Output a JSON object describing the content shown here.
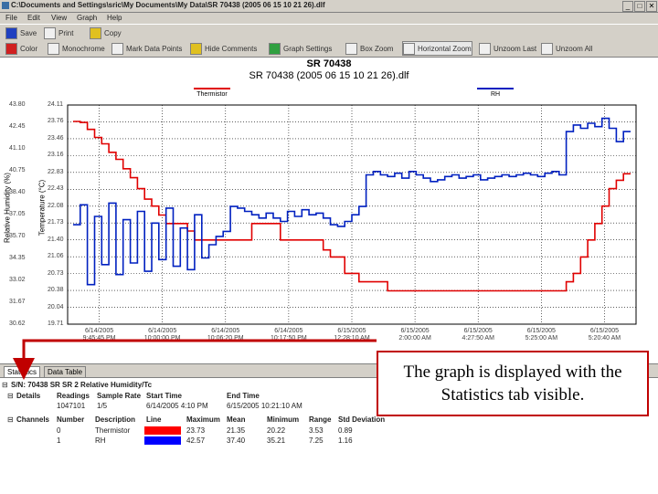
{
  "window": {
    "title": "C:\\Documents and Settings\\sric\\My Documents\\My Data\\SR 70438 (2005 06 15 10 21 26).dlf",
    "controls": [
      "_",
      "□",
      "✕"
    ]
  },
  "menu": [
    "File",
    "Edit",
    "View",
    "Graph",
    "Help"
  ],
  "toolbar1": [
    {
      "label": "Save",
      "icon": "save-icon"
    },
    {
      "label": "Print",
      "icon": "print-icon"
    },
    {
      "label": "Copy",
      "icon": "copy-icon"
    }
  ],
  "toolbar2": [
    {
      "label": "Color",
      "icon": "color-icon"
    },
    {
      "label": "Monochrome",
      "icon": "monochrome-icon"
    },
    {
      "label": "Mark Data Points",
      "icon": "mark-points-icon"
    },
    {
      "label": "Hide Comments",
      "icon": "comments-icon"
    },
    {
      "label": "Graph Settings",
      "icon": "settings-icon"
    },
    {
      "label": "Box Zoom",
      "icon": "box-zoom-icon"
    },
    {
      "label": "Horizontal Zoom",
      "icon": "horizontal-zoom-icon",
      "pressed": true
    },
    {
      "label": "Unzoom Last",
      "icon": "unzoom-last-icon"
    },
    {
      "label": "Unzoom All",
      "icon": "unzoom-all-icon"
    }
  ],
  "chart_data": {
    "type": "line",
    "title": "SR 70438",
    "subtitle": "SR 70438 (2005 06 15 10 21 26).dlf",
    "ylabel_left_outer": "Relative Humidity (%)",
    "ylabel_left_inner": "Temperature (°C)",
    "y_rh_ticks": [
      "43.80",
      "42.45",
      "41.10",
      "40.75",
      "38.40",
      "37.05",
      "35.70",
      "34.35",
      "33.02",
      "31.67",
      "30.62"
    ],
    "y_temp_ticks": [
      "24.11",
      "23.76",
      "23.46",
      "23.16",
      "22.83",
      "22.43",
      "22.08",
      "21.73",
      "21.40",
      "21.06",
      "20.73",
      "20.38",
      "20.04",
      "19.71"
    ],
    "x_ticks": [
      [
        "6/14/2005",
        "9:45:45 PM"
      ],
      [
        "6/14/2005",
        "10:00:00 PM"
      ],
      [
        "6/14/2005",
        "10:06:20 PM"
      ],
      [
        "6/14/2005",
        "10:17:50 PM"
      ],
      [
        "6/15/2005",
        "12:28:10 AM"
      ],
      [
        "6/15/2005",
        "2:00:00 AM"
      ],
      [
        "6/15/2005",
        "4:27:50 AM"
      ],
      [
        "6/15/2005",
        "5:25:00 AM"
      ],
      [
        "6/15/2005",
        "5:20:40 AM"
      ]
    ],
    "series": [
      {
        "name": "Thermistor",
        "color": "#e00000",
        "values": [
          23.78,
          23.76,
          23.62,
          23.46,
          23.33,
          23.16,
          23.02,
          22.83,
          22.65,
          22.43,
          22.22,
          22.08,
          21.9,
          21.73,
          21.73,
          21.73,
          21.58,
          21.4,
          21.4,
          21.4,
          21.4,
          21.4,
          21.4,
          21.4,
          21.4,
          21.73,
          21.73,
          21.73,
          21.73,
          21.4,
          21.4,
          21.4,
          21.4,
          21.4,
          21.4,
          21.2,
          21.06,
          21.06,
          20.73,
          20.73,
          20.56,
          20.56,
          20.56,
          20.56,
          20.38,
          20.38,
          20.38,
          20.38,
          20.38,
          20.38,
          20.38,
          20.38,
          20.38,
          20.38,
          20.38,
          20.38,
          20.38,
          20.38,
          20.38,
          20.38,
          20.38,
          20.38,
          20.38,
          20.38,
          20.38,
          20.38,
          20.38,
          20.38,
          20.38,
          20.56,
          20.73,
          21.06,
          21.4,
          21.73,
          22.08,
          22.43,
          22.6,
          22.73
        ]
      },
      {
        "name": "RH",
        "color": "#0020c0",
        "values": [
          36.6,
          37.8,
          33.0,
          37.1,
          34.2,
          37.9,
          33.6,
          36.9,
          34.3,
          37.4,
          33.8,
          36.7,
          34.5,
          37.6,
          34.1,
          36.4,
          33.9,
          37.2,
          34.6,
          35.4,
          35.9,
          36.2,
          37.7,
          37.6,
          37.4,
          37.2,
          37.0,
          37.3,
          37.0,
          36.8,
          37.4,
          37.1,
          37.5,
          37.2,
          37.3,
          37.0,
          36.6,
          36.5,
          36.8,
          37.2,
          37.7,
          39.6,
          39.8,
          39.6,
          39.5,
          39.7,
          39.4,
          39.8,
          39.6,
          39.4,
          39.2,
          39.3,
          39.5,
          39.6,
          39.4,
          39.5,
          39.6,
          39.3,
          39.4,
          39.5,
          39.6,
          39.5,
          39.6,
          39.7,
          39.6,
          39.5,
          39.7,
          39.8,
          39.6,
          42.2,
          42.6,
          42.4,
          42.7,
          42.5,
          43.0,
          42.4,
          41.6,
          42.2
        ]
      }
    ],
    "legend": [
      "Thermistor",
      "RH"
    ],
    "grid": true,
    "legend_position": "top"
  },
  "tabs": [
    {
      "label": "Statistics",
      "active": true
    },
    {
      "label": "Data Table",
      "active": false
    }
  ],
  "stats": {
    "device": "S/N: 70438 SR SR 2 Relative Humidity/Tc",
    "details_label": "Details",
    "details_headers": [
      "Readings",
      "Sample Rate",
      "Start Time",
      "End Time"
    ],
    "details_values": [
      "1047101",
      "1/5",
      "6/14/2005 4:10 PM",
      "6/15/2005 10:21:10 AM"
    ],
    "channels_label": "Channels",
    "channel_headers": [
      "Number",
      "Description",
      "Line",
      "Maximum",
      "Mean",
      "Minimum",
      "Range",
      "Std Deviation"
    ],
    "channels": [
      {
        "number": "0",
        "description": "Thermistor",
        "color": "#ff0000",
        "maximum": "23.73",
        "mean": "21.35",
        "minimum": "20.22",
        "range": "3.53",
        "std": "0.89"
      },
      {
        "number": "1",
        "description": "RH",
        "color": "#0000ff",
        "maximum": "42.57",
        "mean": "37.40",
        "minimum": "35.21",
        "range": "7.25",
        "std": "1.16"
      }
    ]
  },
  "callout": {
    "text": "The graph is displayed with the Statistics tab visible.",
    "border_color": "#c00000"
  }
}
